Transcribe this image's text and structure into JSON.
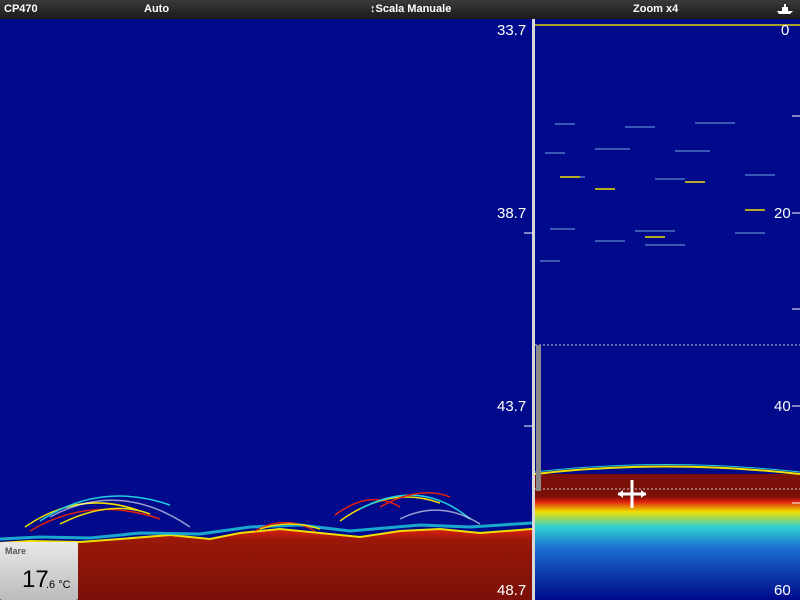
{
  "topbar": {
    "model": "CP470",
    "gain_mode": "Auto",
    "scale_icon": "up-down-arrow-icon",
    "scale_mode": "Scala Manuale",
    "zoom": "Zoom x4",
    "ship_icon": "boat-icon"
  },
  "left_scale": {
    "labels": [
      "33.7",
      "38.7",
      "43.7",
      "48.7"
    ]
  },
  "right_scale": {
    "labels": [
      "0",
      "20",
      "40",
      "60"
    ]
  },
  "temperature": {
    "title": "Mare",
    "integer": "17",
    "decimal": ".6 °C"
  },
  "colors": {
    "water": "#000a8a",
    "bottom": "#7a1008",
    "accent_red": "#e01010",
    "accent_yellow": "#f0e000",
    "accent_cyan": "#20d0e0"
  }
}
